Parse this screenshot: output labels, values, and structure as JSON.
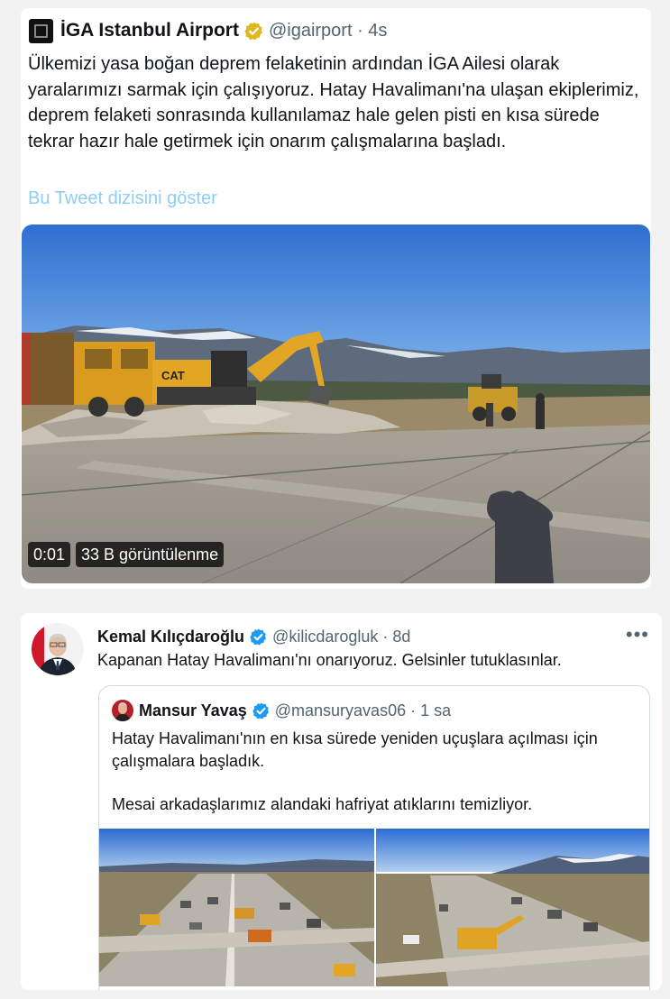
{
  "tweet1": {
    "author_name": "İGA Istanbul Airport",
    "handle_time": "@igairport · 4s",
    "text": "Ülkemizi yasa boğan deprem felaketinin ardından İGA Ailesi olarak yaralarımızı sarmak için çalışıyoruz. Hatay Havalimanı'na ulaşan ekiplerimiz, deprem felaketi sonrasında kullanılamaz hale gelen pisti en kısa sürede tekrar hazır hale getirmek için onarım çalışmalarına başladı.",
    "show_thread": "Bu Tweet dizisini göster",
    "video_time": "0:01",
    "video_views": "33 B görüntülenme",
    "verified_color": "#e2b719",
    "link_color": "#8ecdf8"
  },
  "tweet2": {
    "author_name": "Kemal Kılıçdaroğlu",
    "handle_time": "@kilicdarogluk · 8d",
    "more_icon": "more-horizontal-icon",
    "text": "Kapanan Hatay Havalimanı'nı onarıyoruz. Gelsinler tutuklasınlar.",
    "verified_color": "#1d9bf0",
    "quote": {
      "author_name": "Mansur Yavaş",
      "handle_time": "@mansuryavas06 · 1 sa",
      "para1": "Hatay Havalimanı'nın en kısa sürede yeniden uçuşlara açılması için çalışmalara başladık.",
      "para2": "Mesai arkadaşlarımız alandaki hafriyat atıklarını temizliyor."
    }
  }
}
